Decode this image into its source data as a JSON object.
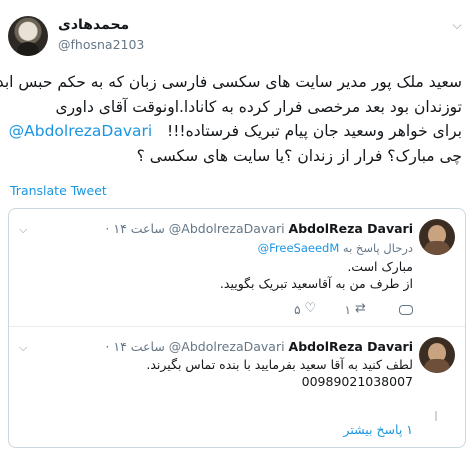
{
  "author": {
    "display_name": "محمدهادی",
    "handle": "@fhosna2103"
  },
  "tweet": {
    "lines": [
      "سعید ملک پور مدیر سایت های سکسی فارسی زبان که به  حکم حبس ابد",
      "توزندان بود بعد مرخصی فرار کرده  به کانادا.اونوقت آقای داوری",
      "برای خواهر وسعید جان پیام تبریک فرستاده!!!",
      "چی مبارک؟ فرار از زندان ؟یا سایت های سکسی ؟"
    ],
    "mention": "@AbdolrezaDavari",
    "translate_label": "Translate Tweet"
  },
  "replies": [
    {
      "name": "AbdolReza Davari",
      "handle": "@AbdolrezaDavari",
      "time": "· ۱۴ ساعت",
      "replying_prefix": "درحال پاسخ به",
      "replying_to": "@FreeSaeedM",
      "body_lines": [
        "مبارک است.",
        "از طرف من به آقاسعید تبریک بگویید."
      ],
      "reply_count": "",
      "retweet_count": "۱",
      "like_count": "۵"
    },
    {
      "name": "AbdolReza Davari",
      "handle": "@AbdolrezaDavari",
      "time": "· ۱۴ ساعت",
      "body_lines": [
        "لطف کنید به آقا سعید بفرمایید با بنده تماس بگیرند.",
        "00989021038007"
      ]
    }
  ],
  "more_replies": "۱ پاسخ بیشتر"
}
